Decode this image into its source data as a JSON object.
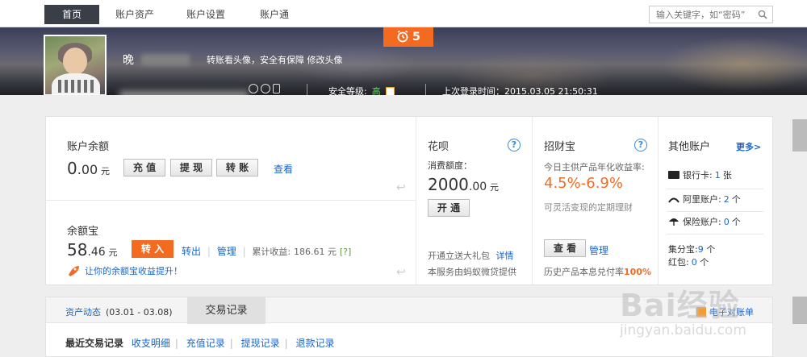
{
  "nav": {
    "tabs": [
      "首页",
      "账户资产",
      "账户设置",
      "账户通"
    ],
    "search_placeholder": "输入关键字，如“密码”"
  },
  "profile": {
    "username": "晚",
    "avatar_hint": "转账看头像，安全有保障",
    "change_avatar": "修改头像",
    "notify_count": "5",
    "security_label": "安全等级:",
    "security_level": "高",
    "last_login": "上次登录时间：2015.03.05 21:50:31"
  },
  "balance": {
    "title": "账户余额",
    "amount_int": "0",
    "amount_dec": ".00",
    "unit": "元",
    "recharge": "充 值",
    "withdraw": "提 现",
    "transfer": "转 账",
    "view": "查看"
  },
  "yuebao": {
    "title": "余额宝",
    "amount_int": "58",
    "amount_dec": ".46",
    "unit": "元",
    "transfer_in": "转 入",
    "transfer_out": "转出",
    "manage": "管理",
    "income_label": "累计收益:",
    "income_value": "186.61 元",
    "income_help": "[?]",
    "promo": "让你的余额宝收益提升！"
  },
  "huabei": {
    "title": "花呗",
    "help": "?",
    "limit_label": "消费额度：",
    "limit_int": "2000",
    "limit_dec": ".00",
    "unit": "元",
    "open": "开 通",
    "gift": "开通立送大礼包",
    "gift_detail": "详情",
    "provider": "本服务由蚂蚁微贷提供"
  },
  "zhaocaibao": {
    "title": "招财宝",
    "help": "?",
    "rate_label": "今日主供产品年化收益率:",
    "rate": "4.5%-6.9%",
    "desc": "可灵活变现的定期理财",
    "view": "查 看",
    "manage": "管理",
    "history_label": "历史产品本息兑付率",
    "history_value": "100%"
  },
  "others": {
    "title": "其他账户",
    "more": "更多>",
    "items": [
      {
        "label": "银行卡:",
        "count": "1",
        "unit": "张"
      },
      {
        "label": "阿里账户:",
        "count": "2",
        "unit": "个"
      },
      {
        "label": "保险账户:",
        "count": "0",
        "unit": "个"
      }
    ],
    "jifenbao": {
      "label": "集分宝:",
      "count": "9",
      "unit": "个"
    },
    "hongbao": {
      "label": "红包:",
      "count": "0",
      "unit": "个"
    }
  },
  "bottom": {
    "activity_label": "资产动态",
    "activity_range": "(03.01 - 03.08)",
    "transactions_tab": "交易记录",
    "ebill": "电子对账单",
    "recent_label": "最近交易记录",
    "links": [
      "收支明细",
      "充值记录",
      "提现记录",
      "退款记录"
    ]
  },
  "watermark": {
    "text": "Bai经验",
    "url": "jingyan.baidu.com"
  },
  "colors": {
    "accent_orange": "#f36b21",
    "link_blue": "#1b66c7",
    "rate_orange": "#f36b21"
  }
}
